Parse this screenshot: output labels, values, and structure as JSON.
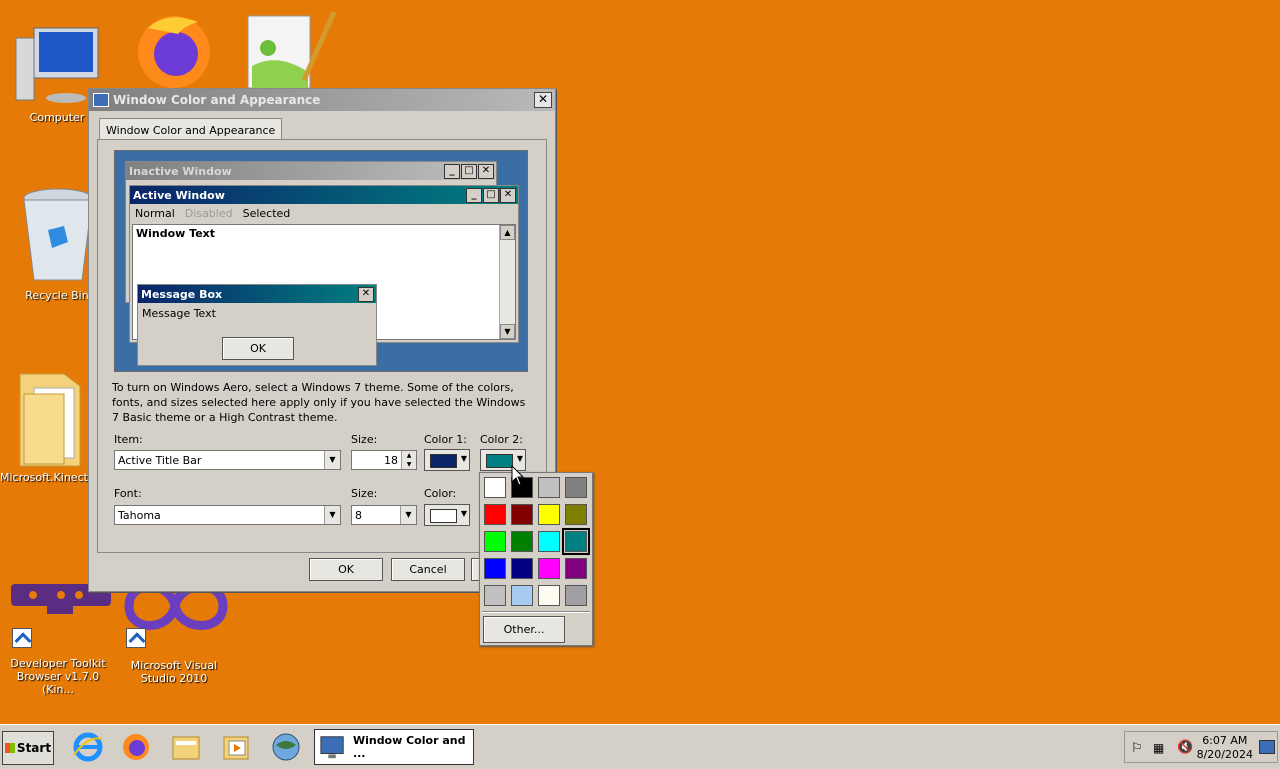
{
  "desktop": {
    "icons": [
      {
        "label": "Computer"
      },
      {
        "label": "Recycle Bin"
      },
      {
        "label": "Microsoft.Kinect.T..."
      },
      {
        "label": "Developer Toolkit Browser v1.7.0 (Kin..."
      },
      {
        "label": "Microsoft Visual Studio 2010"
      }
    ]
  },
  "dialog": {
    "title": "Window Color and Appearance",
    "tab": "Window Color and Appearance",
    "preview": {
      "inactive_title": "Inactive Window",
      "active_title": "Active Window",
      "menu": [
        "Normal",
        "Disabled",
        "Selected"
      ],
      "window_text": "Window Text",
      "msgbox_title": "Message Box",
      "msgbox_text": "Message Text",
      "msgbox_ok": "OK"
    },
    "info": "To turn on Windows Aero, select a Windows 7 theme.  Some of the colors, fonts, and sizes selected here apply only if you have selected the Windows 7 Basic theme or a High Contrast theme.",
    "item_label": "Item:",
    "item_value": "Active Title Bar",
    "size_label": "Size:",
    "size_value": "18",
    "color1_label": "Color 1:",
    "color2_label": "Color 2:",
    "font_label": "Font:",
    "font_value": "Tahoma",
    "font_size_label": "Size:",
    "font_size_value": "8",
    "font_color_label": "Color:",
    "ok": "OK",
    "cancel": "Cancel",
    "colors": {
      "color1": "#0a246a",
      "color2": "#008080",
      "font_color": "#ffffff"
    }
  },
  "popup": {
    "palette": [
      "#ffffff",
      "#000000",
      "#c0c0c0",
      "#808080",
      "#ff0000",
      "#800000",
      "#ffff00",
      "#808000",
      "#00ff00",
      "#008000",
      "#00ffff",
      "#008080",
      "#0000ff",
      "#000080",
      "#ff00ff",
      "#800080",
      "#c0c0c0",
      "#a6caf0",
      "#fffbf0",
      "#a0a0a4"
    ],
    "selected_index": 11,
    "other": "Other..."
  },
  "taskbar": {
    "start": "Start",
    "task_label": "Window Color and ...",
    "time": "6:07 AM",
    "date": "8/20/2024"
  }
}
